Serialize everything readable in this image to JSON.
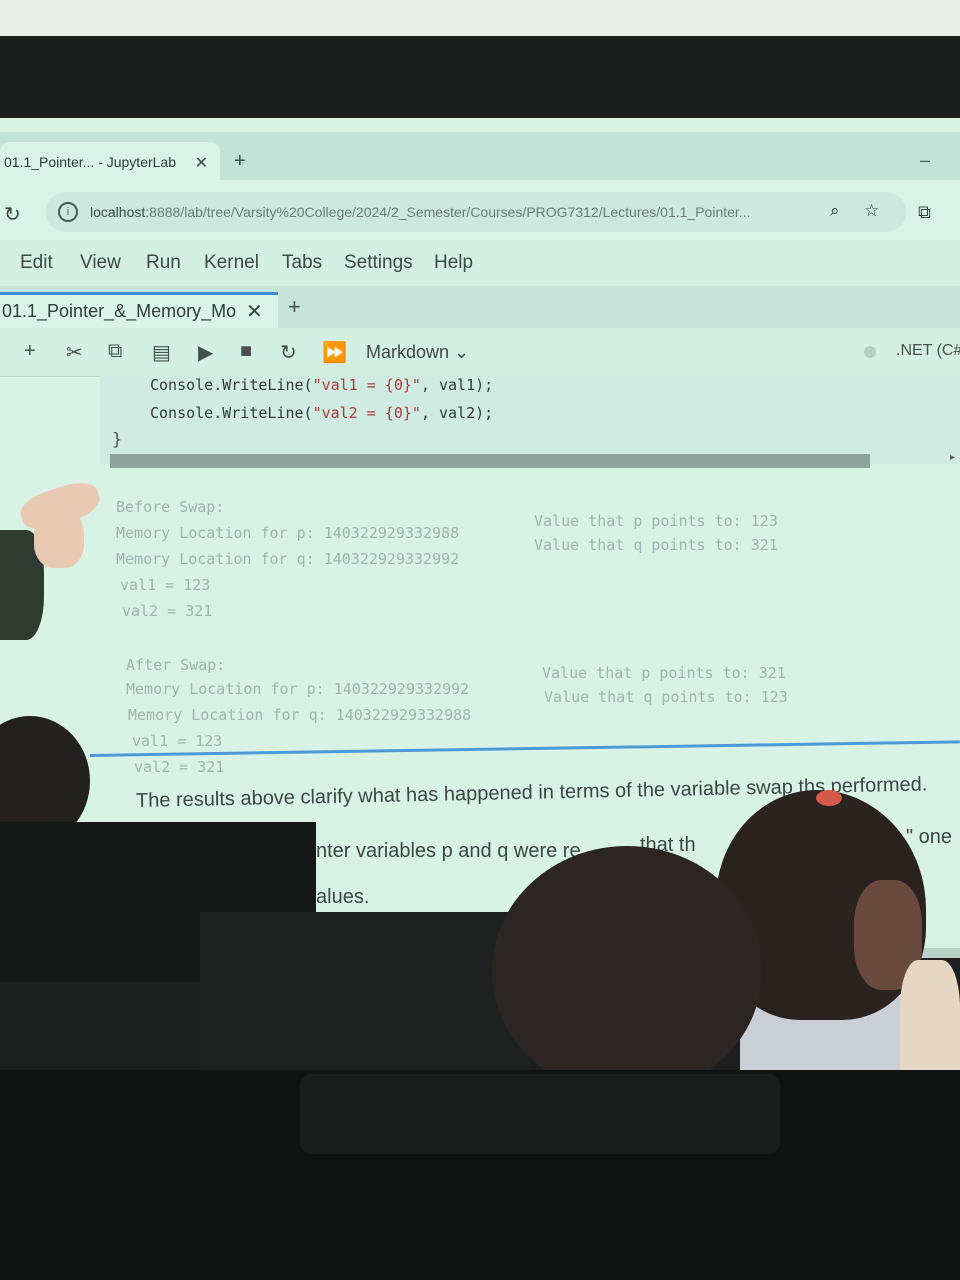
{
  "browser": {
    "tab_title": "01.1_Pointer... - JupyterLab",
    "new_tab": "+",
    "url_host": "localhost",
    "url_path": ":8888/lab/tree/Varsity%20College/2024/2_Semester/Courses/PROG7312/Lectures/01.1_Pointer..."
  },
  "menu": [
    "Edit",
    "View",
    "Run",
    "Kernel",
    "Tabs",
    "Settings",
    "Help"
  ],
  "notebook": {
    "tab_title": "01.1_Pointer_&_Memory_Mo",
    "cell_type": "Markdown",
    "kernel": ".NET (C#"
  },
  "code": {
    "line1_pre": "Console.WriteLine(",
    "line1_str": "\"val1 = {0}\"",
    "line1_post": ", val1);",
    "line2_pre": "Console.WriteLine(",
    "line2_str": "\"val2 = {0}\"",
    "line2_post": ", val2);",
    "brace": "}"
  },
  "output": {
    "before_label": "Before Swap:",
    "before_mem_p": "Memory Location for p: 140322929332988",
    "before_mem_q": "Memory Location for q: 140322929332992",
    "before_val_p": "Value that p points to: 123",
    "before_val_q": "Value that q points to: 321",
    "before_val1": "val1 = 123",
    "before_val2": "val2 = 321",
    "after_label": "After Swap:",
    "after_mem_p": "Memory Location for p: 140322929332992",
    "after_mem_q": "Memory Location for q: 140322929332988",
    "after_val_p": "Value that p points to: 321",
    "after_val_q": "Value that q points to: 123",
    "after_val1": "val1 = 123",
    "after_val2": "val2 = 321"
  },
  "markdown": {
    "line1a": "The results above clarify what has happened in terms of the variable swap th",
    "line1b": "s performed.",
    "line2a": "nter variables p and q were re",
    "line2b": "that th",
    "line2c": "\" one",
    "line3": "alues."
  }
}
